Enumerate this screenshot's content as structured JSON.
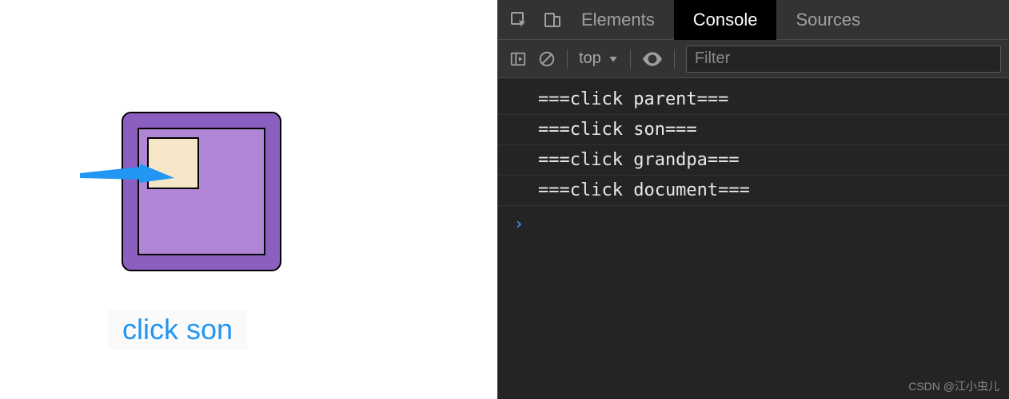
{
  "left": {
    "caption": "click son"
  },
  "devtools": {
    "tabs": {
      "elements": "Elements",
      "console": "Console",
      "sources": "Sources"
    },
    "toolbar": {
      "context": "top",
      "filter_placeholder": "Filter"
    },
    "console_lines": [
      "===click parent===",
      "===click son===",
      "===click grandpa===",
      "===click document==="
    ],
    "prompt": "›"
  },
  "watermark": "CSDN @江小虫儿"
}
